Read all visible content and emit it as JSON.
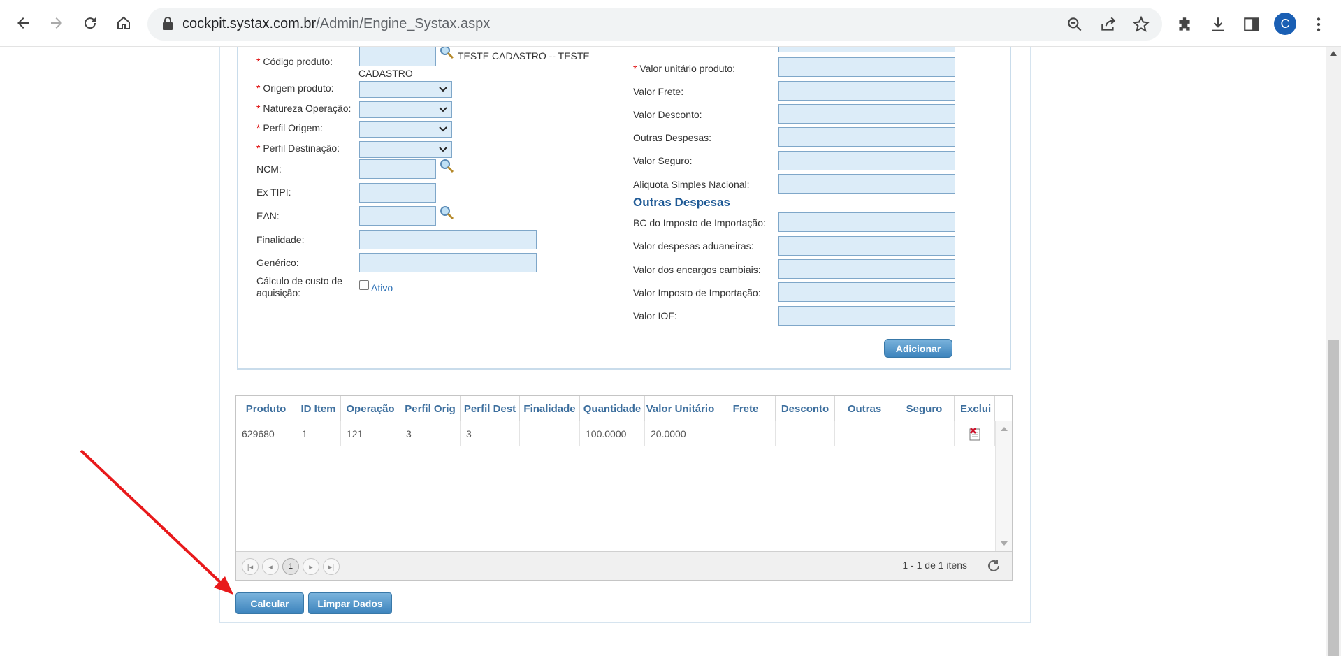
{
  "browser": {
    "url_host": "cockpit.systax.com.br",
    "url_path": "/Admin/Engine_Systax.aspx",
    "avatar_letter": "C"
  },
  "form_left": {
    "codigo_produto_label": "Código produto:",
    "codigo_produto_desc_line1": "TESTE CADASTRO -- TESTE",
    "codigo_produto_desc_line2": "CADASTRO",
    "origem_produto_label": "Origem produto:",
    "natureza_operacao_label": "Natureza Operação:",
    "perfil_origem_label": "Perfil Origem:",
    "perfil_destinacao_label": "Perfil Destinação:",
    "ncm_label": "NCM:",
    "ex_tipi_label": "Ex TIPI:",
    "ean_label": "EAN:",
    "finalidade_label": "Finalidade:",
    "generico_label": "Genérico:",
    "calculo_custo_label_line1": "Cálculo de custo de",
    "calculo_custo_label_line2": "aquisição:",
    "ativo_label": "Ativo",
    "required_marker": "*"
  },
  "form_right": {
    "valor_unitario_label": "Valor unitário produto:",
    "valor_frete_label": "Valor Frete:",
    "valor_desconto_label": "Valor Desconto:",
    "outras_despesas_label": "Outras Despesas:",
    "valor_seguro_label": "Valor Seguro:",
    "aliquota_label": "Aliquota Simples Nacional:",
    "section_outras_despesas": "Outras Despesas",
    "bc_importacao_label": "BC do Imposto de Importação:",
    "despesas_aduaneiras_label": "Valor despesas aduaneiras:",
    "encargos_cambiais_label": "Valor dos encargos cambiais:",
    "imposto_importacao_label": "Valor Imposto de Importação:",
    "valor_iof_label": "Valor IOF:",
    "adicionar_button": "Adicionar"
  },
  "grid": {
    "columns": [
      "Produto",
      "ID Item",
      "Operação",
      "Perfil Orig",
      "Perfil Dest",
      "Finalidade",
      "Quantidade",
      "Valor Unitário",
      "Frete",
      "Desconto",
      "Outras",
      "Seguro",
      "Exclui"
    ],
    "rows": [
      [
        "629680",
        "1",
        "121",
        "3",
        "3",
        "",
        "100.0000",
        "20.0000",
        "",
        "",
        "",
        "",
        ""
      ]
    ],
    "current_page": "1",
    "pager_info": "1 - 1 de 1 itens"
  },
  "actions": {
    "calcular_button": "Calcular",
    "limpar_button": "Limpar Dados"
  },
  "colors": {
    "input_bg": "#dcecf8",
    "header_text": "#3d6f9e",
    "button_blue": "#3d84bd",
    "annotation_arrow": "#e8191b"
  }
}
